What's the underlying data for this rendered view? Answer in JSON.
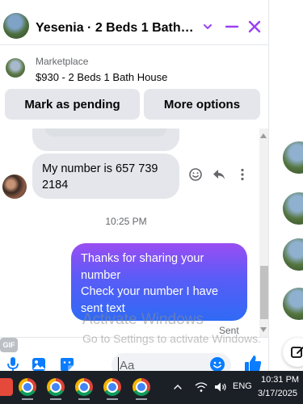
{
  "header": {
    "title": "Yesenia · 2 Beds 1 Bath Ho..."
  },
  "listing": {
    "source": "Marketplace",
    "title": "$930 - 2 Beds 1 Bath House",
    "mark_pending_label": "Mark as pending",
    "more_options_label": "More options"
  },
  "messages": {
    "incoming_text": "My number is 657 739 2184",
    "timestamp": "10:25 PM",
    "outgoing_line1": "Thanks for sharing your number",
    "outgoing_line2": "Check your number I have sent text",
    "status": "Sent"
  },
  "composer": {
    "placeholder": "Aa",
    "gif_label": "GIF"
  },
  "watermark": {
    "line1": "Activate Windows",
    "line2": "Go to Settings to activate Windows."
  },
  "taskbar": {
    "language": "ENG",
    "time": "10:31 PM",
    "date": "3/17/2025"
  },
  "colors": {
    "accent": "#9b3ff3",
    "bubble_gradient_top": "#9a4df2",
    "bubble_gradient_bottom": "#2f6af5",
    "incoming_bubble": "#e4e6eb",
    "messenger_blue": "#0a7cff",
    "taskbar_bg": "#1b2027"
  },
  "icons": {
    "header": [
      "chevron-down-icon",
      "minimize-icon",
      "close-icon"
    ],
    "message_actions": [
      "emoji-react-icon",
      "reply-icon",
      "more-vertical-icon"
    ],
    "composer": [
      "microphone-icon",
      "photo-icon",
      "sticker-icon",
      "gif-icon",
      "emoji-icon",
      "thumbs-up-icon"
    ]
  }
}
